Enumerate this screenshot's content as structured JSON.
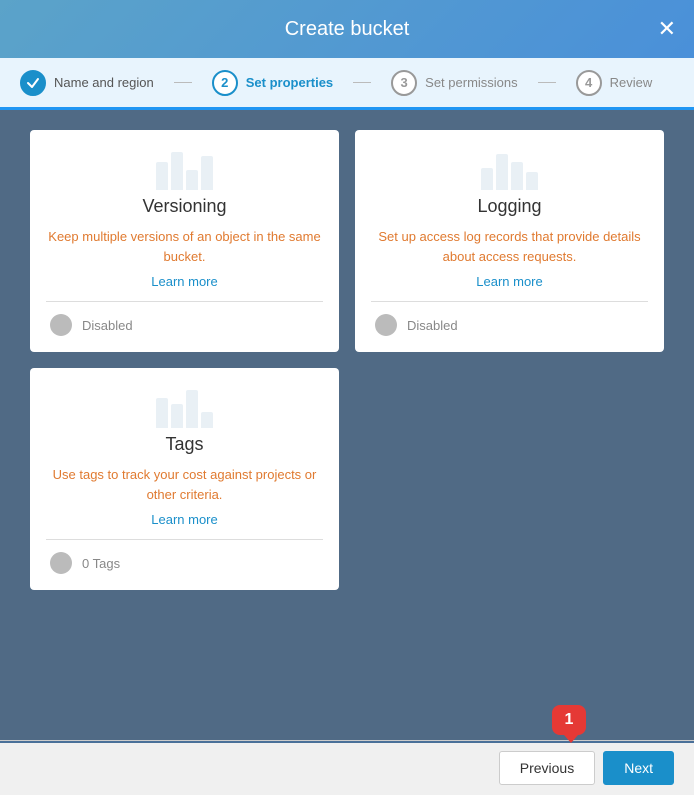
{
  "modal": {
    "title": "Create bucket",
    "close_label": "✕"
  },
  "steps": [
    {
      "id": 1,
      "label": "Name and region",
      "state": "completed"
    },
    {
      "id": 2,
      "label": "Set properties",
      "state": "active"
    },
    {
      "id": 3,
      "label": "Set permissions",
      "state": "inactive"
    },
    {
      "id": 4,
      "label": "Review",
      "state": "inactive"
    }
  ],
  "cards": [
    {
      "title": "Versioning",
      "description": "Keep multiple versions of an object in the same bucket.",
      "learn_more": "Learn more",
      "toggle_label": "Disabled"
    },
    {
      "title": "Logging",
      "description": "Set up access log records that provide details about access requests.",
      "learn_more": "Learn more",
      "toggle_label": "Disabled"
    },
    {
      "title": "Tags",
      "description": "Use tags to track your cost against projects or other criteria.",
      "learn_more": "Learn more",
      "toggle_label": "0 Tags"
    }
  ],
  "footer": {
    "previous_label": "Previous",
    "next_label": "Next",
    "notification_count": "1"
  }
}
